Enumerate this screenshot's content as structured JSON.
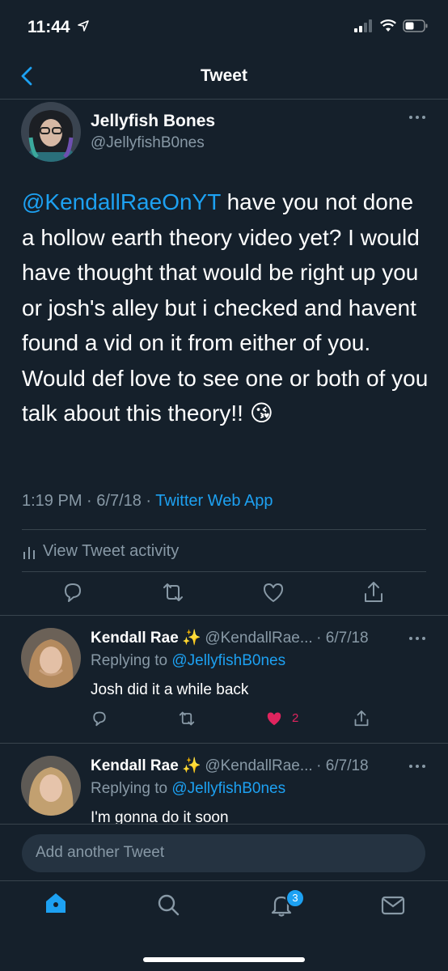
{
  "status_bar": {
    "time": "11:44"
  },
  "header": {
    "title": "Tweet"
  },
  "main_tweet": {
    "author_name": "Jellyfish Bones",
    "author_handle": "@JellyfishB0nes",
    "mention": "@KendallRaeOnYT",
    "text": " have you not done a hollow earth theory video yet? I would have thought that would be right up you or josh's alley but i checked and havent found a vid on it from either of you. Would def love to see one or both of you talk about this theory!! 😘",
    "time": "1:19 PM",
    "date": "6/7/18",
    "separator": " · ",
    "source": "Twitter Web App",
    "view_activity": "View Tweet activity"
  },
  "replies": [
    {
      "name": "Kendall Rae",
      "emoji": "✨",
      "handle": "@KendallRae...",
      "date": "· 6/7/18",
      "replying_prefix": "Replying to ",
      "replying_to": "@JellyfishB0nes",
      "text": "Josh did it a while back",
      "like_count": "2"
    },
    {
      "name": "Kendall Rae",
      "emoji": "✨",
      "handle": "@KendallRae...",
      "date": "· 6/7/18",
      "replying_prefix": "Replying to ",
      "replying_to": "@JellyfishB0nes",
      "text": "I'm gonna do it soon"
    }
  ],
  "compose": {
    "placeholder": "Add another Tweet"
  },
  "tab_bar": {
    "notifications_badge": "3"
  },
  "colors": {
    "background": "#15202b",
    "accent": "#1da1f2",
    "like": "#e0245e",
    "muted": "#8899a6"
  },
  "icons": [
    "location-arrow-icon",
    "signal-icon",
    "wifi-icon",
    "battery-icon",
    "back-chevron-icon",
    "more-icon",
    "bar-chart-icon",
    "reply-icon",
    "retweet-icon",
    "like-icon",
    "share-icon",
    "home-icon",
    "search-icon",
    "notifications-icon",
    "messages-icon"
  ]
}
